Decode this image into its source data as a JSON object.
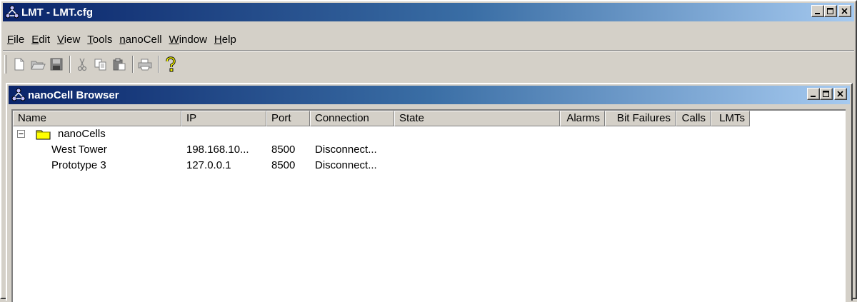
{
  "window": {
    "title": "LMT - LMT.cfg",
    "icon": "lmt-network-icon",
    "controls": [
      "minimize-icon",
      "maximize-icon",
      "close-icon"
    ]
  },
  "menu": [
    {
      "label": "File",
      "accel": "F",
      "rest": "ile"
    },
    {
      "label": "Edit",
      "accel": "E",
      "rest": "dit"
    },
    {
      "label": "View",
      "accel": "V",
      "rest": "iew"
    },
    {
      "label": "Tools",
      "accel": "T",
      "rest": "ools"
    },
    {
      "label": "nanoCell",
      "accel": "n",
      "rest": "anoCell"
    },
    {
      "label": "Window",
      "accel": "W",
      "rest": "indow"
    },
    {
      "label": "Help",
      "accel": "H",
      "rest": "elp"
    }
  ],
  "toolbar": {
    "buttons": [
      "new-file-icon",
      "open-folder-icon",
      "save-icon",
      "cut-icon",
      "copy-icon",
      "paste-icon",
      "print-icon",
      "help-icon"
    ]
  },
  "browser": {
    "title": "nanoCell Browser",
    "columns": [
      {
        "label": "Name"
      },
      {
        "label": "IP"
      },
      {
        "label": "Port"
      },
      {
        "label": "Connection"
      },
      {
        "label": "State"
      },
      {
        "label": "Alarms"
      },
      {
        "label": "Bit Failures"
      },
      {
        "label": "Calls"
      },
      {
        "label": "LMTs"
      }
    ],
    "tree_root": {
      "label": "nanoCells",
      "toggle": "−"
    },
    "rows": [
      {
        "name": "West Tower",
        "ip": "198.168.10...",
        "port": "8500",
        "connection": "Disconnect..."
      },
      {
        "name": "Prototype 3",
        "ip": "127.0.0.1",
        "port": "8500",
        "connection": "Disconnect..."
      }
    ]
  },
  "colors": {
    "title_active_start": "#0a246a",
    "title_active_end": "#a6caf0",
    "face": "#d4d0c8",
    "folder_yellow": "#ffff00"
  }
}
